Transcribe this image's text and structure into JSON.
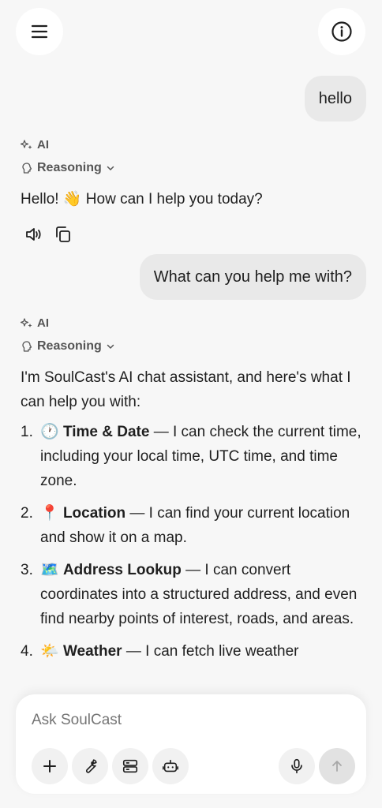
{
  "header": {
    "menu_icon": "menu-icon",
    "info_icon": "info-icon"
  },
  "messages": [
    {
      "role": "user",
      "text": "hello"
    },
    {
      "role": "ai",
      "label": "AI",
      "reasoning": "Reasoning",
      "text": "Hello! 👋 How can I help you today?"
    },
    {
      "role": "user",
      "text": "What can you help me with?"
    },
    {
      "role": "ai",
      "label": "AI",
      "reasoning": "Reasoning",
      "intro": "I'm SoulCast's AI chat assistant, and here's what I can help you with:",
      "items": [
        {
          "num": "1.",
          "emoji": "🕐",
          "title": "Time & Date",
          "text": " — I can check the current time, including your local time, UTC time, and time zone."
        },
        {
          "num": "2.",
          "emoji": "📍",
          "title": "Location",
          "text": " — I can find your current location and show it on a map."
        },
        {
          "num": "3.",
          "emoji": "🗺️",
          "title": "Address Lookup",
          "text": " — I can convert coordinates into a structured address, and even find nearby points of interest, roads, and areas."
        },
        {
          "num": "4.",
          "emoji": "🌤️",
          "title": "Weather",
          "text": " — I can fetch live weather"
        }
      ]
    }
  ],
  "composer": {
    "placeholder": "Ask SoulCast",
    "tools": [
      "plus-icon",
      "wrench-icon",
      "server-icon",
      "bot-icon",
      "microphone-icon",
      "send-arrow-icon"
    ]
  }
}
